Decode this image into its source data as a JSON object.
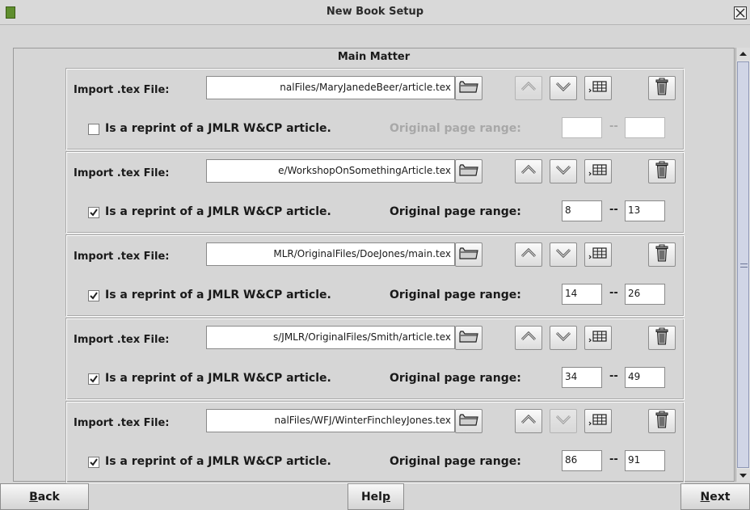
{
  "window": {
    "title": "New Book Setup",
    "app_icon": "book-icon",
    "close_icon": "close-icon"
  },
  "main": {
    "section_title": "Main Matter",
    "import_label": "Import .tex File:",
    "reprint_label": "Is a reprint of a JMLR W&CP article.",
    "range_label": "Original page range:",
    "range_separator": "--",
    "entries": [
      {
        "file": "nalFiles/MaryJanedeBeer/article.tex",
        "reprint": false,
        "range_start": "",
        "range_end": "",
        "up_enabled": false,
        "down_enabled": true
      },
      {
        "file": "e/WorkshopOnSomethingArticle.tex",
        "reprint": true,
        "range_start": "8",
        "range_end": "13",
        "up_enabled": true,
        "down_enabled": true
      },
      {
        "file": "MLR/OriginalFiles/DoeJones/main.tex",
        "reprint": true,
        "range_start": "14",
        "range_end": "26",
        "up_enabled": true,
        "down_enabled": true
      },
      {
        "file": "s/JMLR/OriginalFiles/Smith/article.tex",
        "reprint": true,
        "range_start": "34",
        "range_end": "49",
        "up_enabled": true,
        "down_enabled": true
      },
      {
        "file": "nalFiles/WFJ/WinterFinchleyJones.tex",
        "reprint": true,
        "range_start": "86",
        "range_end": "91",
        "up_enabled": true,
        "down_enabled": false
      }
    ]
  },
  "footer": {
    "back_mnemonic": "B",
    "back_rest": "ack",
    "help_prefix": "Hel",
    "help_mnemonic": "p",
    "next_mnemonic": "N",
    "next_rest": "ext"
  }
}
